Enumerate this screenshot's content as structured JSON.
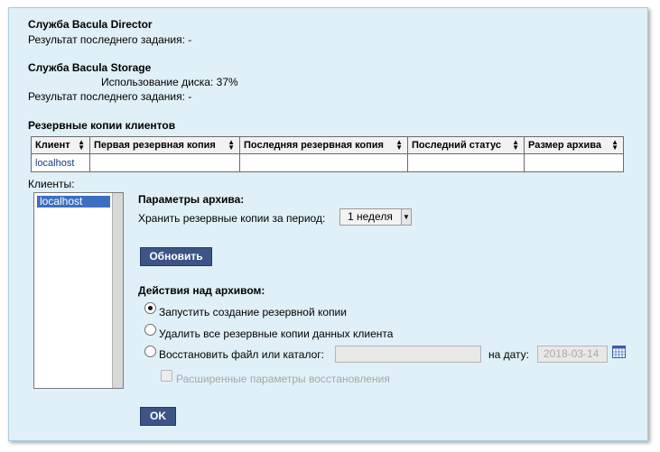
{
  "director": {
    "title": "Служба Bacula Director",
    "last_job": "Результат последнего задания: -"
  },
  "storage": {
    "title": "Служба Bacula Storage",
    "disk_usage": "Использование диска: 37%",
    "last_job": "Результат последнего задания: -"
  },
  "backups": {
    "title": "Резервные копии клиентов",
    "columns": [
      "Клиент",
      "Первая резервная копия",
      "Последняя резервная копия",
      "Последний статус",
      "Размер архива"
    ],
    "rows": [
      [
        "localhost",
        "",
        "",
        "",
        ""
      ]
    ]
  },
  "clients": {
    "label": "Клиенты:",
    "items": [
      "localhost"
    ],
    "selected": "localhost"
  },
  "archive_params": {
    "title": "Параметры архива:",
    "retention_label": "Хранить резервные копии за период:",
    "retention_value": "1 неделя",
    "refresh_button": "Обновить"
  },
  "actions": {
    "title": "Действия над архивом:",
    "options": [
      "Запустить создание резервной копии",
      "Удалить все резервные копии данных клиента",
      "Восстановить файл или каталог:"
    ],
    "selected_index": 0,
    "restore_path": "",
    "date_label": "на дату:",
    "date_value": "2018-03-14",
    "advanced_label": "Расширенные параметры восстановления",
    "ok_button": "OK"
  }
}
